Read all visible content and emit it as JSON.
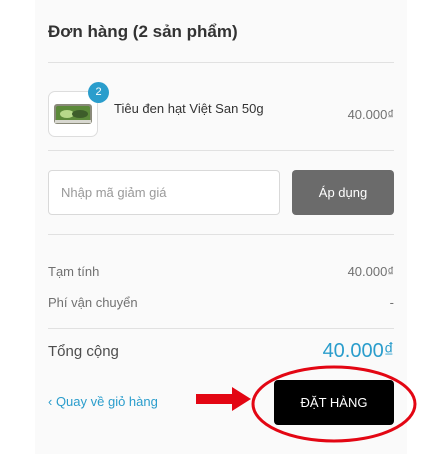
{
  "cart": {
    "title": "Đơn hàng (2 sản phẩm)",
    "items": [
      {
        "name": "Tiêu đen hạt Việt San 50g",
        "quantity": "2",
        "price": "40.000₫"
      }
    ]
  },
  "coupon": {
    "placeholder": "Nhập mã giảm giá",
    "apply_label": "Áp dụng"
  },
  "summary": {
    "subtotal_label": "Tạm tính",
    "subtotal_value": "40.000₫",
    "shipping_label": "Phí vận chuyển",
    "shipping_value": "-",
    "total_label": "Tổng cộng",
    "total_value": "40.000₫"
  },
  "actions": {
    "back_label": "‹ Quay về giỏ hàng",
    "order_label": "ĐẶT HÀNG"
  },
  "colors": {
    "accent": "#2a9dcc",
    "apply_button": "#6b6b6b",
    "order_button": "#000000",
    "annotation": "#e30613"
  }
}
